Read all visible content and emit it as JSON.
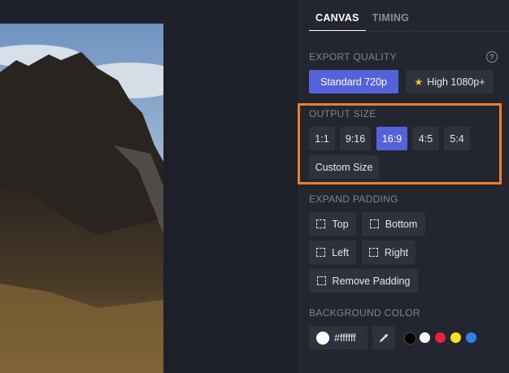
{
  "tabs": [
    {
      "label": "CANVAS",
      "active": true
    },
    {
      "label": "TIMING",
      "active": false
    }
  ],
  "export_quality": {
    "label": "EXPORT QUALITY",
    "help": "?",
    "options": [
      "Standard 720p",
      "High 1080p+"
    ],
    "selected": "Standard 720p"
  },
  "output_size": {
    "label": "OUTPUT SIZE",
    "options": [
      "1:1",
      "9:16",
      "16:9",
      "4:5",
      "5:4"
    ],
    "selected": "16:9",
    "custom_label": "Custom Size"
  },
  "expand_padding": {
    "label": "EXPAND PADDING",
    "top": "Top",
    "bottom": "Bottom",
    "left": "Left",
    "right": "Right",
    "remove": "Remove Padding"
  },
  "background_color": {
    "label": "BACKGROUND COLOR",
    "value": "#ffffff",
    "presets": [
      "#000000",
      "#ffffff",
      "#e8223a",
      "#f5e11c",
      "#2f80e8"
    ]
  },
  "colors": {
    "accent": "#5463db",
    "highlight": "#ef7d2b",
    "star": "#f4c430"
  }
}
